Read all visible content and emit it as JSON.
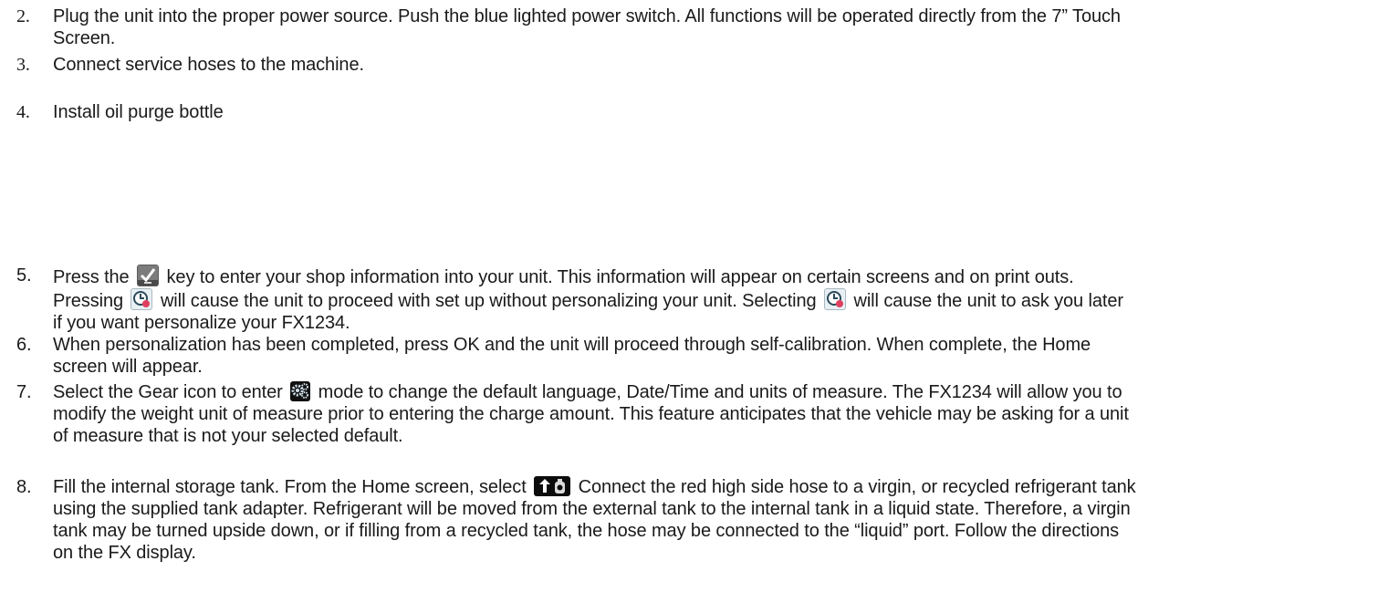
{
  "steps": [
    {
      "number": "2.",
      "lines": [
        "Plug the unit into the proper power source.  Push the blue lighted power switch.  All functions will be operated directly from the 7” Touch",
        "Screen."
      ]
    },
    {
      "number": "3.",
      "lines": [
        "Connect service hoses to the machine."
      ]
    },
    {
      "number": "4.",
      "lines": [
        "Install oil purge bottle"
      ]
    },
    {
      "number": "5.",
      "line1_a": "Press the",
      "line1_b": "key to enter your shop information into your unit.  This information will appear on certain screens and on print outs.",
      "line2_a": "Pressing",
      "line2_b": "will cause the unit to proceed with set up without personalizing your unit.  Selecting",
      "line2_c": "will cause the unit to ask you later",
      "line3": "if you want personalize your FX1234."
    },
    {
      "number": "6.",
      "lines": [
        "When personalization has been completed, press OK and the unit will proceed through self-calibration.  When complete, the Home",
        "screen will appear."
      ]
    },
    {
      "number": "7.",
      "line1_a": "Select the Gear icon to enter",
      "line1_b": "mode to change the default language, Date/Time and units of measure.  The FX1234 will allow you to",
      "line2": "modify the weight unit of measure prior to entering the charge amount.   This feature anticipates that the vehicle may be asking for a unit",
      "line3": "of measure that is not your selected default."
    },
    {
      "number": "8.",
      "line1_a": "Fill the internal storage tank.  From the Home screen, select",
      "line1_b": "Connect the red high side hose to a virgin, or recycled refrigerant tank",
      "line2": "using the supplied tank adapter.  Refrigerant will be moved from the external tank to the internal tank in a liquid state.  Therefore, a virgin",
      "line3": "tank may be turned upside down, or if filling from a recycled tank, the hose may be connected to the “liquid” port.  Follow the directions",
      "line4": "on the FX display."
    }
  ],
  "icons": {
    "check": "checkmark-key-icon",
    "clock": "later-clock-icon",
    "gear": "gear-settings-icon",
    "fill": "fill-tank-icon"
  }
}
